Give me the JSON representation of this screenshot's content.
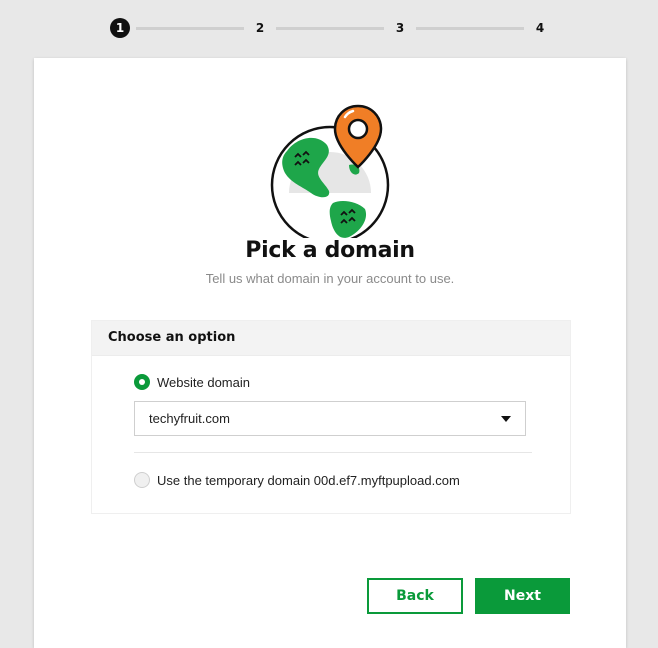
{
  "stepper": {
    "steps": [
      {
        "label": "1",
        "active": true
      },
      {
        "label": "2",
        "active": false
      },
      {
        "label": "3",
        "active": false
      },
      {
        "label": "4",
        "active": false
      }
    ]
  },
  "header": {
    "title": "Pick a domain",
    "subtitle": "Tell us what domain in your account to use."
  },
  "options": {
    "heading": "Choose an option",
    "website_domain_label": "Website domain",
    "website_domain_selected": true,
    "domain_select_value": "techyfruit.com",
    "temporary_domain_label": "Use the temporary domain 00d.ef7.myftpupload.com",
    "temporary_domain_selected": false
  },
  "actions": {
    "back_label": "Back",
    "next_label": "Next"
  },
  "icons": {
    "hero": "globe-with-location-pin-icon",
    "dropdown": "caret-down-icon"
  },
  "colors": {
    "accent": "#0a9a3a",
    "pin": "#f07e26",
    "globe_land": "#1ea64a"
  }
}
